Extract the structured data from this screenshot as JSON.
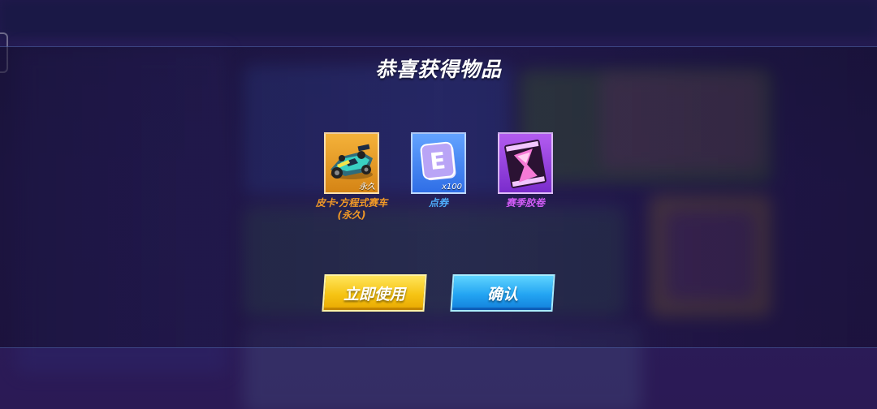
{
  "dialog": {
    "title": "恭喜获得物品"
  },
  "rewards": [
    {
      "name": "皮卡·方程式赛车",
      "name_line2": "(永久)",
      "tag": "永久",
      "icon": "formula-kart-icon",
      "color": "#f39a26"
    },
    {
      "name": "点券",
      "tag": "x100",
      "icon": "e-coupon-icon",
      "color": "#4fb1ff"
    },
    {
      "name": "赛季胶卷",
      "tag": "",
      "icon": "hourglass-film-icon",
      "color": "#d15cf6"
    }
  ],
  "buttons": {
    "use_now": "立即使用",
    "confirm": "确认"
  }
}
